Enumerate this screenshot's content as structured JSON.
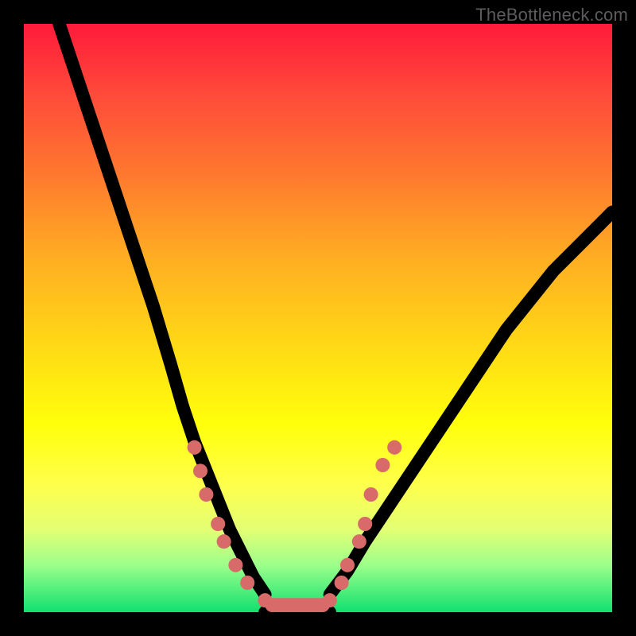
{
  "watermark": "TheBottleneck.com",
  "chart_data": {
    "type": "line",
    "title": "",
    "xlabel": "",
    "ylabel": "",
    "xlim": [
      0,
      100
    ],
    "ylim": [
      0,
      100
    ],
    "grid": false,
    "gradient_stops": [
      {
        "pct": 0,
        "color": "#ff1a3a"
      },
      {
        "pct": 12,
        "color": "#ff4a3a"
      },
      {
        "pct": 26,
        "color": "#ff7a2e"
      },
      {
        "pct": 40,
        "color": "#ffae22"
      },
      {
        "pct": 54,
        "color": "#ffd716"
      },
      {
        "pct": 68,
        "color": "#ffff0b"
      },
      {
        "pct": 78,
        "color": "#ffff4a"
      },
      {
        "pct": 86,
        "color": "#e3ff74"
      },
      {
        "pct": 92,
        "color": "#9cff8a"
      },
      {
        "pct": 100,
        "color": "#10e070"
      }
    ],
    "series": [
      {
        "name": "left_branch",
        "x": [
          6,
          10,
          14,
          18,
          22,
          25,
          27,
          29,
          31,
          33,
          35,
          37,
          39,
          41
        ],
        "y": [
          100,
          88,
          76,
          64,
          52,
          42,
          35,
          29,
          24,
          19,
          14,
          10,
          6,
          3
        ]
      },
      {
        "name": "valley_flat",
        "x": [
          41,
          52
        ],
        "y": [
          0,
          0
        ]
      },
      {
        "name": "right_branch",
        "x": [
          52,
          55,
          58,
          62,
          66,
          70,
          74,
          78,
          82,
          86,
          90,
          94,
          98,
          100
        ],
        "y": [
          3,
          7,
          12,
          18,
          24,
          30,
          36,
          42,
          48,
          53,
          58,
          62,
          66,
          68
        ]
      }
    ],
    "highlight_points": {
      "color": "#d86a6a",
      "radius": 9,
      "points": [
        {
          "x": 29,
          "y": 28
        },
        {
          "x": 30,
          "y": 24
        },
        {
          "x": 31,
          "y": 20
        },
        {
          "x": 33,
          "y": 15
        },
        {
          "x": 34,
          "y": 12
        },
        {
          "x": 36,
          "y": 8
        },
        {
          "x": 38,
          "y": 5
        },
        {
          "x": 41,
          "y": 2
        },
        {
          "x": 52,
          "y": 2
        },
        {
          "x": 54,
          "y": 5
        },
        {
          "x": 55,
          "y": 8
        },
        {
          "x": 57,
          "y": 12
        },
        {
          "x": 58,
          "y": 15
        },
        {
          "x": 59,
          "y": 20
        },
        {
          "x": 61,
          "y": 25
        },
        {
          "x": 63,
          "y": 28
        }
      ]
    },
    "valley_bar": {
      "x0": 41,
      "x1": 52,
      "y": 1.2,
      "height": 2.4,
      "color": "#d86a6a"
    }
  }
}
